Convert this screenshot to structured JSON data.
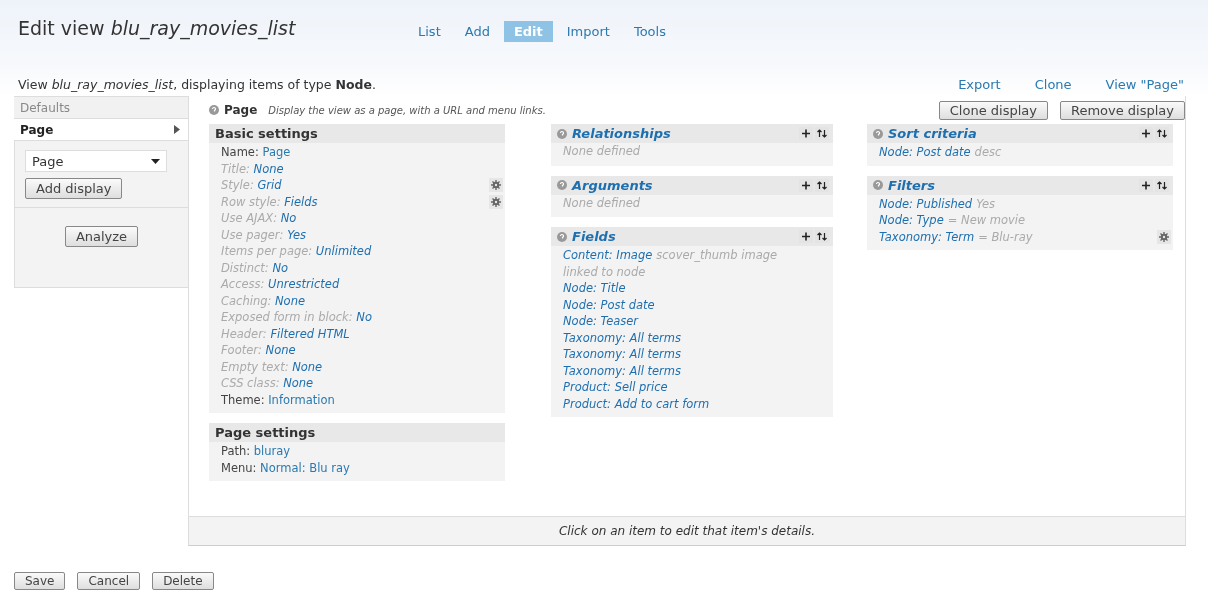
{
  "title": {
    "prefix": "Edit view ",
    "name": "blu_ray_movies_list"
  },
  "tabs": [
    {
      "label": "List",
      "selected": false
    },
    {
      "label": "Add",
      "selected": false
    },
    {
      "label": "Edit",
      "selected": true
    },
    {
      "label": "Import",
      "selected": false
    },
    {
      "label": "Tools",
      "selected": false
    }
  ],
  "description": "View *blu_ray_movies_list*, displaying items of type **Node**.",
  "links": [
    "Export",
    "Clone",
    "View \"Page\""
  ],
  "displays": [
    {
      "label": "Defaults",
      "selected": false
    },
    {
      "label": "Page",
      "selected": true
    }
  ],
  "display_select": {
    "value": "Page"
  },
  "add_display_button": "Add display",
  "analyze_button": "Analyze",
  "display_header": {
    "name": "Page",
    "description": "Display the view as a page, with a URL and menu links."
  },
  "display_buttons": [
    "Clone display",
    "Remove display"
  ],
  "settings_blocks": [
    {
      "title": "Basic settings",
      "rows": [
        {
          "label": "Name:",
          "value": "Page",
          "inherited": false,
          "gear": false
        },
        {
          "label": "Title:",
          "value": "None",
          "inherited": true,
          "gear": false
        },
        {
          "label": "Style:",
          "value": "Grid",
          "inherited": true,
          "gear": true
        },
        {
          "label": "Row style:",
          "value": "Fields",
          "inherited": true,
          "gear": true
        },
        {
          "label": "Use AJAX:",
          "value": "No",
          "inherited": true,
          "gear": false
        },
        {
          "label": "Use pager:",
          "value": "Yes",
          "inherited": true,
          "gear": false
        },
        {
          "label": "Items per page:",
          "value": "Unlimited",
          "inherited": true,
          "gear": false
        },
        {
          "label": "Distinct:",
          "value": "No",
          "inherited": true,
          "gear": false
        },
        {
          "label": "Access:",
          "value": "Unrestricted",
          "inherited": true,
          "gear": false
        },
        {
          "label": "Caching:",
          "value": "None",
          "inherited": true,
          "gear": false
        },
        {
          "label": "Exposed form in block:",
          "value": "No",
          "inherited": true,
          "gear": false
        },
        {
          "label": "Header:",
          "value": "Filtered HTML",
          "inherited": true,
          "gear": false
        },
        {
          "label": "Footer:",
          "value": "None",
          "inherited": true,
          "gear": false
        },
        {
          "label": "Empty text:",
          "value": "None",
          "inherited": true,
          "gear": false
        },
        {
          "label": "CSS class:",
          "value": "None",
          "inherited": true,
          "gear": false
        },
        {
          "label": "Theme:",
          "value": "Information",
          "inherited": false,
          "gear": false
        }
      ]
    },
    {
      "title": "Page settings",
      "rows": [
        {
          "label": "Path:",
          "value": "bluray",
          "inherited": false,
          "gear": false
        },
        {
          "label": "Menu:",
          "value": "Normal: Blu ray",
          "inherited": false,
          "gear": false
        }
      ]
    }
  ],
  "columns": [
    [
      {
        "title": "Relationships",
        "empty": "None defined"
      },
      {
        "title": "Arguments",
        "empty": "None defined"
      },
      {
        "title": "Fields",
        "items": [
          {
            "label": "Content: Image",
            "note": "scover_thumb image linked to node",
            "gear": false
          },
          {
            "label": "Node: Title",
            "gear": false
          },
          {
            "label": "Node: Post date",
            "gear": false
          },
          {
            "label": "Node: Teaser",
            "gear": false
          },
          {
            "label": "Taxonomy: All terms",
            "gear": false
          },
          {
            "label": "Taxonomy: All terms",
            "gear": false
          },
          {
            "label": "Taxonomy: All terms",
            "gear": false
          },
          {
            "label": "Product: Sell price",
            "gear": false
          },
          {
            "label": "Product: Add to cart form",
            "gear": false
          }
        ]
      }
    ],
    [
      {
        "title": "Sort criteria",
        "items": [
          {
            "label": "Node: Post date",
            "note": "desc",
            "gear": false
          }
        ]
      },
      {
        "title": "Filters",
        "items": [
          {
            "label": "Node: Published",
            "note": "Yes",
            "gear": false
          },
          {
            "label": "Node: Type",
            "note": "= New movie",
            "gear": false
          },
          {
            "label": "Taxonomy: Term",
            "note": "= Blu-ray",
            "gear": true
          }
        ]
      }
    ]
  ],
  "status": "Click on an item to edit that item's details.",
  "buttons": [
    "Save",
    "Cancel",
    "Delete"
  ]
}
